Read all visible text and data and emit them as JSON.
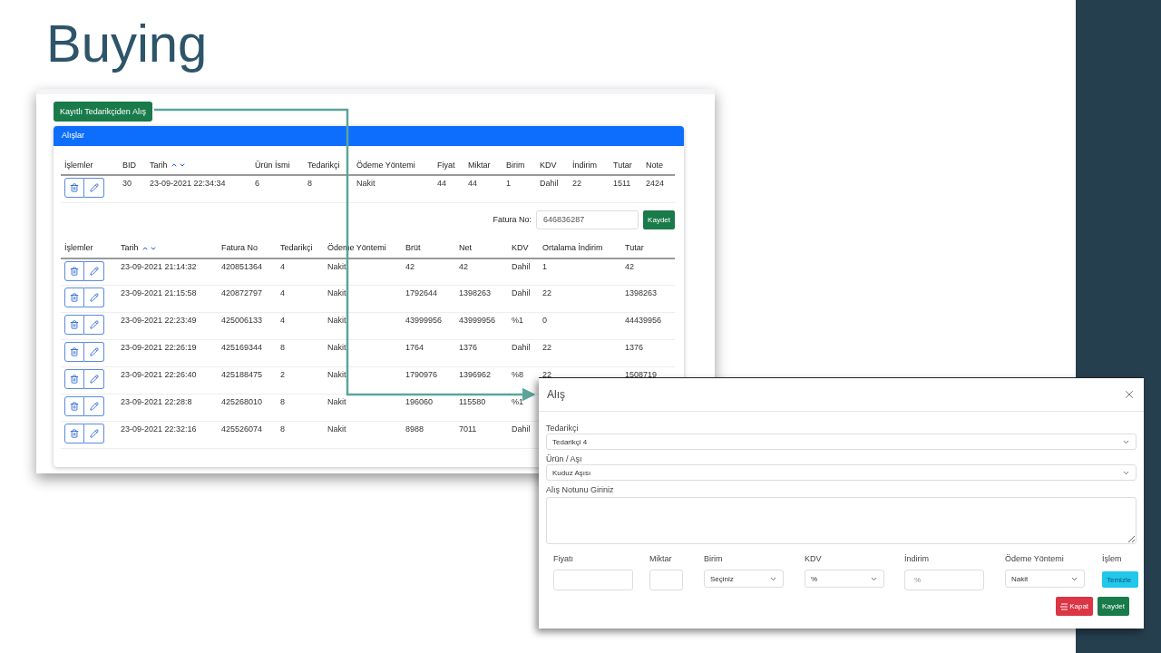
{
  "slide": {
    "title": "Buying"
  },
  "app": {
    "add_button": "Kayıtlı Tedarikçiden Alış",
    "card_title": "Alışlar",
    "cart_table": {
      "columns": [
        {
          "label": "İşlemler",
          "sortable": false
        },
        {
          "label": "BID",
          "sortable": false
        },
        {
          "label": "Tarih",
          "sortable": true
        },
        {
          "label": "Ürün İsmi",
          "sortable": false
        },
        {
          "label": "Tedarikçi",
          "sortable": false
        },
        {
          "label": "Ödeme Yöntemi",
          "sortable": false
        },
        {
          "label": "Fiyat",
          "sortable": false
        },
        {
          "label": "Miktar",
          "sortable": false
        },
        {
          "label": "Birim",
          "sortable": false
        },
        {
          "label": "KDV",
          "sortable": false
        },
        {
          "label": "İndirim",
          "sortable": false
        },
        {
          "label": "Tutar",
          "sortable": false
        },
        {
          "label": "Note",
          "sortable": false
        }
      ],
      "rows": [
        {
          "cells": [
            "",
            "30",
            "23-09-2021 22:34:34",
            "6",
            "8",
            "Nakit",
            "44",
            "44",
            "1",
            "Dahil",
            "22",
            "1511",
            "2424"
          ]
        }
      ]
    },
    "invoice": {
      "label": "Fatura No:",
      "value": "646836287",
      "button": "Kaydet"
    },
    "purchases_table": {
      "columns": [
        {
          "label": "İşlemler",
          "sortable": false
        },
        {
          "label": "Tarih",
          "sortable": true
        },
        {
          "label": "Fatura No",
          "sortable": false
        },
        {
          "label": "Tedarikçi",
          "sortable": false
        },
        {
          "label": "Ödeme Yöntemi",
          "sortable": false
        },
        {
          "label": "Brüt",
          "sortable": false
        },
        {
          "label": "Net",
          "sortable": false
        },
        {
          "label": "KDV",
          "sortable": false
        },
        {
          "label": "Ortalama İndirim",
          "sortable": false
        },
        {
          "label": "Tutar",
          "sortable": false
        }
      ],
      "rows": [
        {
          "cells": [
            "",
            "23-09-2021 21:14:32",
            "420851364",
            "4",
            "Nakit",
            "42",
            "42",
            "Dahil",
            "1",
            "42"
          ]
        },
        {
          "cells": [
            "",
            "23-09-2021 21:15:58",
            "420872797",
            "4",
            "Nakit",
            "1792644",
            "1398263",
            "Dahil",
            "22",
            "1398263"
          ]
        },
        {
          "cells": [
            "",
            "23-09-2021 22:23:49",
            "425006133",
            "4",
            "Nakit",
            "43999956",
            "43999956",
            "%1",
            "0",
            "44439956"
          ]
        },
        {
          "cells": [
            "",
            "23-09-2021 22:26:19",
            "425169344",
            "8",
            "Nakit",
            "1764",
            "1376",
            "Dahil",
            "22",
            "1376"
          ]
        },
        {
          "cells": [
            "",
            "23-09-2021 22:26:40",
            "425188475",
            "2",
            "Nakit",
            "1790976",
            "1396962",
            "%8",
            "22",
            "1508719"
          ]
        },
        {
          "cells": [
            "",
            "23-09-2021 22:28:8",
            "425268010",
            "8",
            "Nakit",
            "196060",
            "115580",
            "%1"
          ]
        },
        {
          "cells": [
            "",
            "23-09-2021 22:32:16",
            "425526074",
            "8",
            "Nakit",
            "8988",
            "7011",
            "Dahil"
          ]
        }
      ]
    }
  },
  "modal": {
    "title": "Alış",
    "fields": [
      {
        "kind": "select",
        "label": "Tedarikçi",
        "value": "Tedarikçi 4"
      },
      {
        "kind": "select",
        "label": "Ürün / Aşı",
        "value": "Kuduz Aşısı"
      },
      {
        "kind": "textarea",
        "label": "Alış Notunu Giriniz"
      }
    ],
    "inline_fields": [
      {
        "kind": "input",
        "label": "Fiyatı"
      },
      {
        "kind": "input",
        "label": "Miktar"
      },
      {
        "kind": "select",
        "label": "Birim",
        "value": "Seçiniz"
      },
      {
        "kind": "select",
        "label": "KDV",
        "value": "%"
      },
      {
        "kind": "input",
        "label": "İndirim",
        "placeholder": "%"
      },
      {
        "kind": "select",
        "label": "Ödeme Yöntemi",
        "value": "Nakit"
      },
      {
        "kind": "button",
        "label": "İşlem",
        "button": "Temizle"
      }
    ],
    "buttons": [
      {
        "kind": "danger",
        "label": "Kapat"
      },
      {
        "kind": "success",
        "label": "Kaydet"
      }
    ]
  }
}
